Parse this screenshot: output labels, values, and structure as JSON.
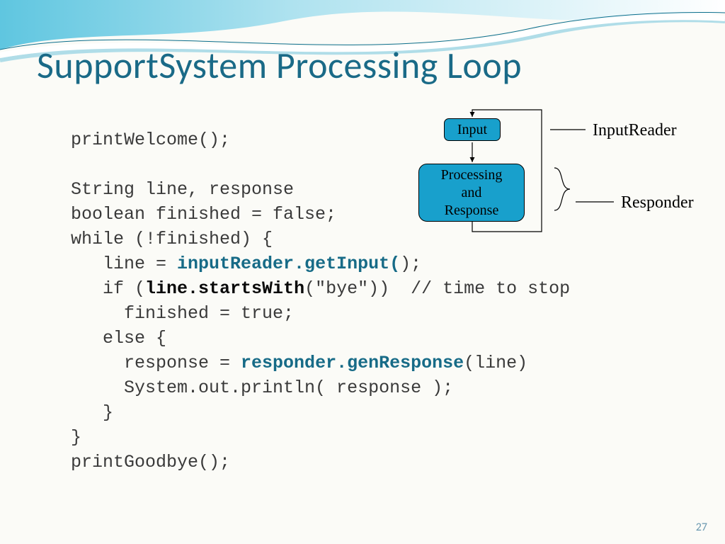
{
  "title": "SupportSystem Processing Loop",
  "code": {
    "l1": "printWelcome();",
    "l2": "",
    "l3": "String line, response",
    "l4": "boolean finished = false;",
    "l5a": "while (!finished) {",
    "l6a": "   line = ",
    "l6b": "inputReader.getInput(",
    "l6c": ");",
    "l7a": "   if (",
    "l7b": "line.startsWith",
    "l7c": "(\"bye\"))  // time to stop",
    "l8": "     finished = true;",
    "l9": "   else {",
    "l10a": "     response = ",
    "l10b": "responder.genResponse",
    "l10c": "(line)",
    "l11": "     System.out.println( response );",
    "l12": "   }",
    "l13": "}",
    "l14": "printGoodbye();"
  },
  "diagram": {
    "input": "Input",
    "proc1": "Processing",
    "proc2": "and",
    "proc3": "Response",
    "label_ir": "InputReader",
    "label_rs": "Responder"
  },
  "page": "27"
}
